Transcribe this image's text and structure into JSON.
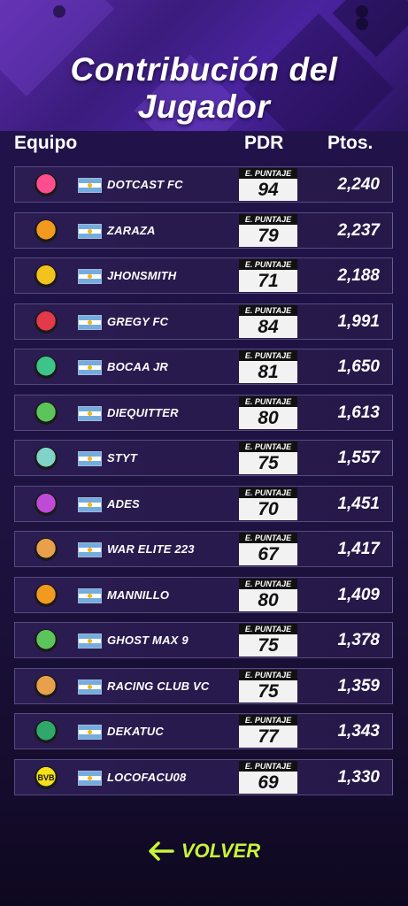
{
  "header": {
    "title": "Contribución del Jugador"
  },
  "columns": {
    "team": "Equipo",
    "pdr": "PDR",
    "pts": "Ptos."
  },
  "score_label": "E. PUNTAJE",
  "rows": [
    {
      "name": "DOTCAST FC",
      "score": "94",
      "points": "2,240",
      "crest": "dotcast-crest-icon",
      "crest_color": "#ff4d8d"
    },
    {
      "name": "ZARAZA",
      "score": "79",
      "points": "2,237",
      "crest": "zaraza-crest-icon",
      "crest_color": "#f29a1f"
    },
    {
      "name": "JHONSMITH",
      "score": "71",
      "points": "2,188",
      "crest": "jhonsmith-crest-icon",
      "crest_color": "#f2c21f"
    },
    {
      "name": "GREGY FC",
      "score": "84",
      "points": "1,991",
      "crest": "gregy-crest-icon",
      "crest_color": "#e23a4a"
    },
    {
      "name": "BOCAA JR",
      "score": "81",
      "points": "1,650",
      "crest": "bocaa-crest-icon",
      "crest_color": "#3cc48a"
    },
    {
      "name": "DIEQUITTER",
      "score": "80",
      "points": "1,613",
      "crest": "diequitter-crest-icon",
      "crest_color": "#5cc45a"
    },
    {
      "name": "STYT",
      "score": "75",
      "points": "1,557",
      "crest": "styt-crest-icon",
      "crest_color": "#7fd3c7"
    },
    {
      "name": "ADES",
      "score": "70",
      "points": "1,451",
      "crest": "ades-crest-icon",
      "crest_color": "#c04ad8"
    },
    {
      "name": "WAR ELITE 223",
      "score": "67",
      "points": "1,417",
      "crest": "mountain-crest-icon",
      "crest_color": "#e8a04a"
    },
    {
      "name": "MANNILLO",
      "score": "80",
      "points": "1,409",
      "crest": "mannillo-crest-icon",
      "crest_color": "#f29a1f"
    },
    {
      "name": "GHOST MAX 9",
      "score": "75",
      "points": "1,378",
      "crest": "ghostmax-crest-icon",
      "crest_color": "#5cc45a"
    },
    {
      "name": "RACING CLUB VC",
      "score": "75",
      "points": "1,359",
      "crest": "mountain-crest-icon",
      "crest_color": "#e8a04a"
    },
    {
      "name": "DEKATUC",
      "score": "77",
      "points": "1,343",
      "crest": "dekatuc-crest-icon",
      "crest_color": "#2fa86a"
    },
    {
      "name": "LOCOFACU08",
      "score": "69",
      "points": "1,330",
      "crest": "bvb-crest-icon",
      "crest_color": "#f5e01a",
      "crest_text": "BVB"
    }
  ],
  "footer": {
    "back_label": "VOLVER",
    "accent": "#c8f53a"
  }
}
